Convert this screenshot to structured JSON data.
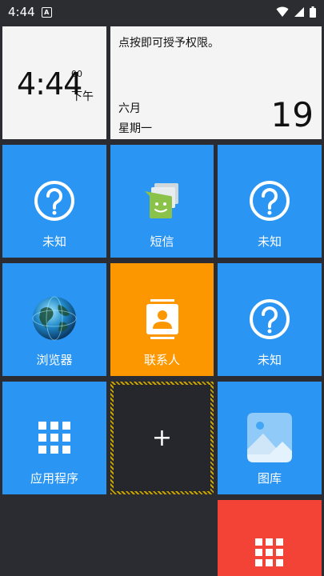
{
  "status_bar": {
    "time": "4:44",
    "notification_icon": "A",
    "icons": [
      "wifi-icon",
      "signal-icon",
      "battery-icon"
    ]
  },
  "clock": {
    "time": "4:44",
    "seconds": "00",
    "ampm": "下午"
  },
  "calendar": {
    "permission_text": "点按即可授予权限。",
    "month": "六月",
    "weekday": "星期一",
    "day": "19"
  },
  "tiles": {
    "unknown_1": "未知",
    "sms": "短信",
    "unknown_2": "未知",
    "browser": "浏览器",
    "contacts": "联系人",
    "unknown_3": "未知",
    "apps": "应用程序",
    "add": "+",
    "gallery": "图库"
  },
  "colors": {
    "tile_blue": "#2a95f2",
    "tile_orange": "#fd9700",
    "tile_red": "#f34336",
    "background": "#2a2c31",
    "add_border": "#c9a300"
  }
}
